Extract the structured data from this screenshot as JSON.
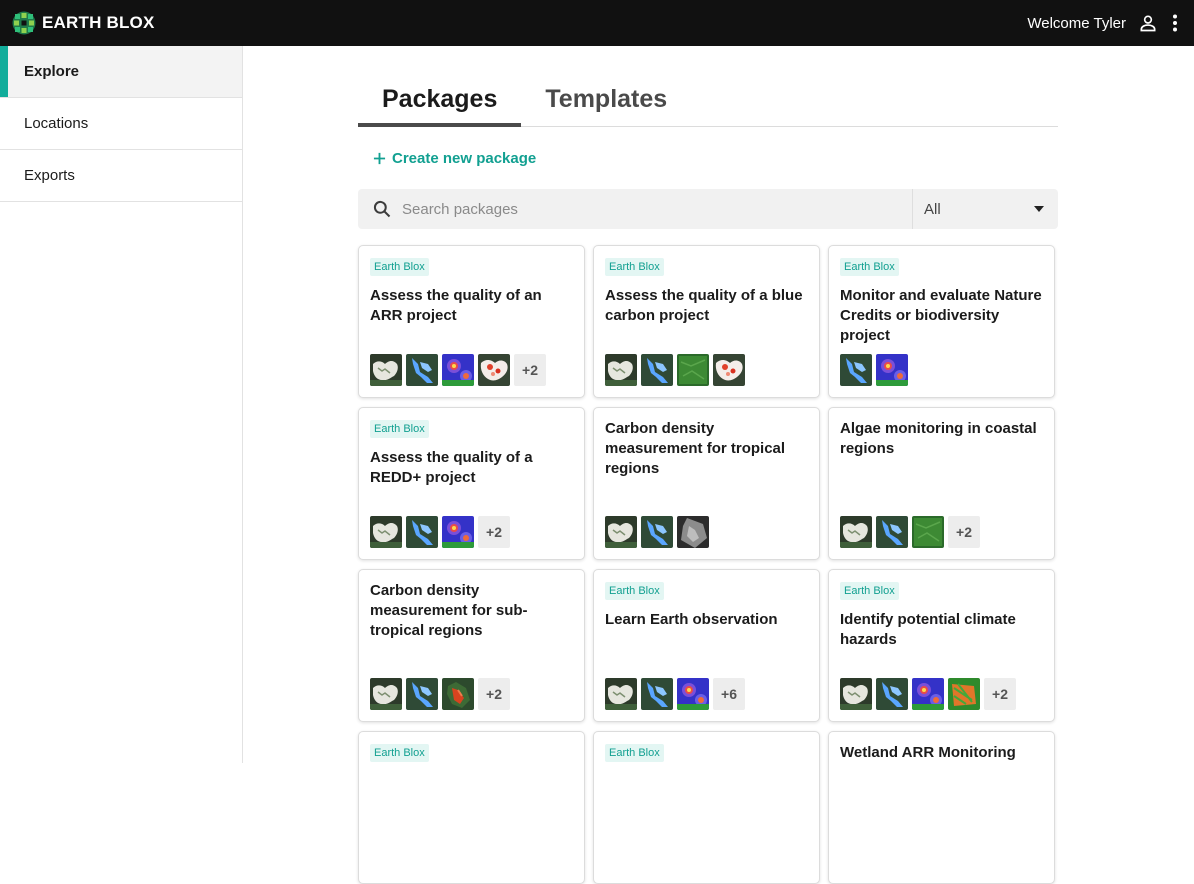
{
  "header": {
    "brand": "EARTH BLOX",
    "welcome": "Welcome Tyler"
  },
  "sidebar": {
    "items": [
      {
        "label": "Explore",
        "active": true
      },
      {
        "label": "Locations",
        "active": false
      },
      {
        "label": "Exports",
        "active": false
      }
    ]
  },
  "tabs": [
    {
      "label": "Packages",
      "active": true
    },
    {
      "label": "Templates",
      "active": false
    }
  ],
  "create_label": "Create new package",
  "search": {
    "placeholder": "Search packages",
    "filter_value": "All"
  },
  "colors": {
    "accent": "#12a091",
    "topbar": "#111111",
    "badge_bg": "#e3f6f3"
  },
  "cards": [
    {
      "badge": "Earth Blox",
      "title": "Assess the quality of an ARR project",
      "thumbs": [
        "forest-map",
        "water-map",
        "heat-map",
        "white-red-map"
      ],
      "more": "+2"
    },
    {
      "badge": "Earth Blox",
      "title": "Assess the quality of a blue carbon project",
      "thumbs": [
        "forest-map",
        "water-map",
        "green-map",
        "white-red-map"
      ],
      "more": ""
    },
    {
      "badge": "Earth Blox",
      "title": "Monitor and evaluate Nature Credits or biodiversity project",
      "thumbs": [
        "water-map",
        "heat-map"
      ],
      "more": ""
    },
    {
      "badge": "Earth Blox",
      "title": "Assess the quality of a REDD+ project",
      "thumbs": [
        "forest-map",
        "water-map",
        "heat-map"
      ],
      "more": "+2"
    },
    {
      "badge": "",
      "title": "Carbon density measurement for tropical regions",
      "thumbs": [
        "forest-map",
        "water-map",
        "gray-map"
      ],
      "more": ""
    },
    {
      "badge": "",
      "title": "Algae monitoring in coastal regions",
      "thumbs": [
        "forest-map",
        "water-map",
        "green-map"
      ],
      "more": "+2"
    },
    {
      "badge": "",
      "title": "Carbon density measurement for sub-tropical regions",
      "thumbs": [
        "forest-map",
        "water-map",
        "red-green-map"
      ],
      "more": "+2"
    },
    {
      "badge": "Earth Blox",
      "title": "Learn Earth observation",
      "thumbs": [
        "forest-map",
        "water-map",
        "heat-map"
      ],
      "more": "+6"
    },
    {
      "badge": "Earth Blox",
      "title": "Identify potential climate hazards",
      "thumbs": [
        "forest-map",
        "water-map",
        "heat-map",
        "orange-green-map"
      ],
      "more": "+2"
    },
    {
      "badge": "Earth Blox",
      "title": "",
      "thumbs": [],
      "more": ""
    },
    {
      "badge": "Earth Blox",
      "title": "",
      "thumbs": [],
      "more": ""
    },
    {
      "badge": "",
      "title": "Wetland ARR Monitoring",
      "thumbs": [],
      "more": ""
    }
  ]
}
